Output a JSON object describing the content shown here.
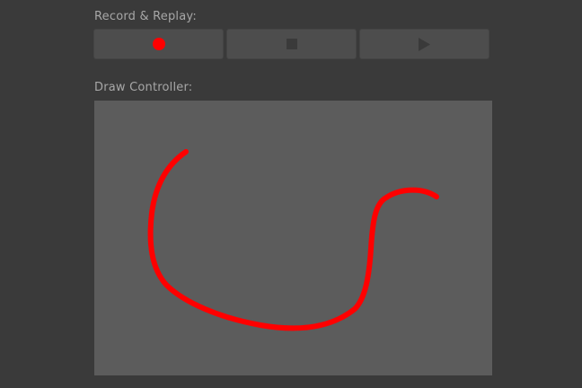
{
  "record_replay": {
    "heading": "Record & Replay:",
    "buttons": [
      {
        "name": "record",
        "icon": "record-dot-icon",
        "color": "#ff0000"
      },
      {
        "name": "stop",
        "icon": "stop-square-icon",
        "color": "#3a3a3a"
      },
      {
        "name": "play",
        "icon": "play-triangle-icon",
        "color": "#3a3a3a"
      }
    ]
  },
  "draw_controller": {
    "heading": "Draw Controller:",
    "stroke_color": "#ff0000",
    "background_color": "#5c5c5c"
  }
}
